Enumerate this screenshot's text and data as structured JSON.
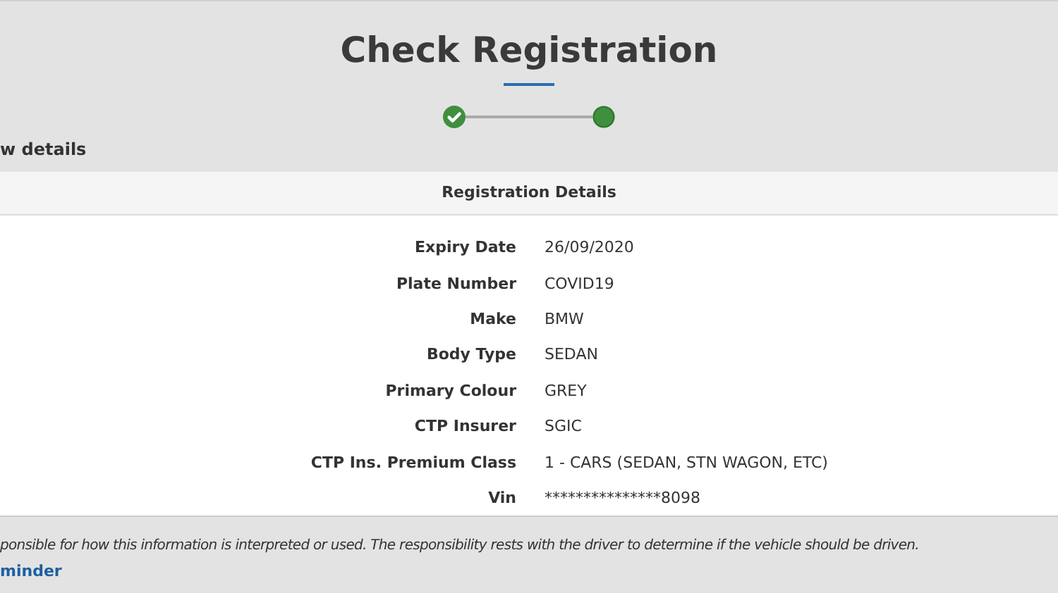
{
  "title": "Check Registration",
  "steps": [
    {
      "done": true
    },
    {
      "done": false
    }
  ],
  "section_title": "w details",
  "table": {
    "heading": "Registration Details",
    "rows": [
      {
        "label": "Expiry Date",
        "value": "26/09/2020"
      },
      {
        "label": "Plate Number",
        "value": "COVID19"
      },
      {
        "label": "Make",
        "value": "BMW"
      },
      {
        "label": "Body Type",
        "value": "SEDAN"
      },
      {
        "label": "Primary Colour",
        "value": "GREY"
      },
      {
        "label": "CTP Insurer",
        "value": "SGIC"
      },
      {
        "label": "CTP Ins. Premium Class",
        "value": "1 - CARS (SEDAN, STN WAGON, ETC)"
      },
      {
        "label": "Vin",
        "value": "***************8098"
      }
    ]
  },
  "disclaimer": "ponsible for how this information is interpreted or used. The responsibility rests with the driver to determine if the vehicle should be driven.",
  "link": "minder"
}
